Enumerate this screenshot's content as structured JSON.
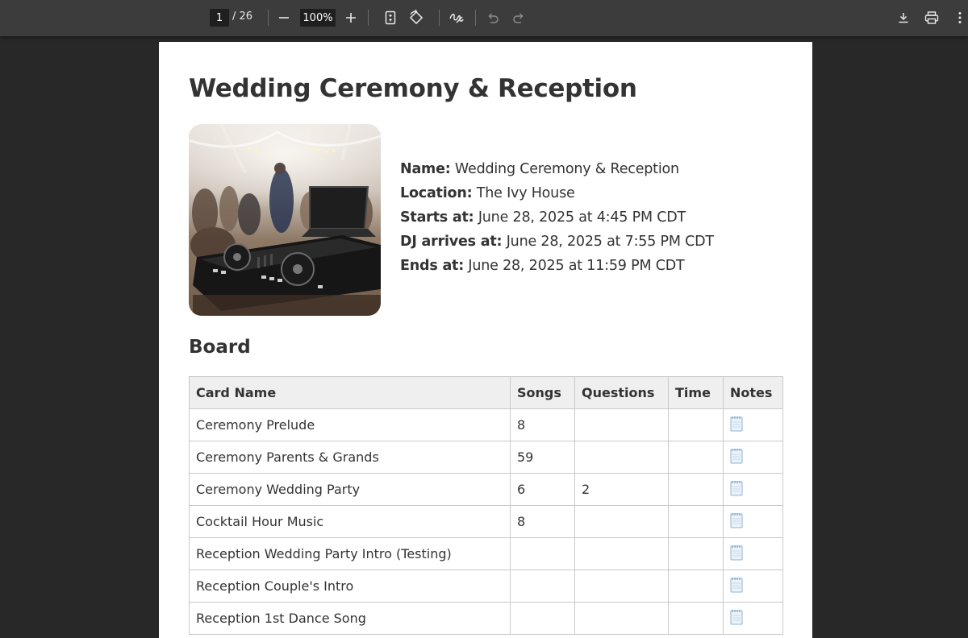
{
  "toolbar": {
    "current_page": "1",
    "total_pages": "/ 26",
    "zoom": "100%"
  },
  "document": {
    "title": "Wedding Ceremony & Reception",
    "info": [
      {
        "label": "Name:",
        "value": " Wedding Ceremony & Reception"
      },
      {
        "label": "Location:",
        "value": " The Ivy House"
      },
      {
        "label": "Starts at:",
        "value": " June 28, 2025 at 4:45 PM CDT"
      },
      {
        "label": "DJ arrives at:",
        "value": " June 28, 2025 at 7:55 PM CDT"
      },
      {
        "label": "Ends at:",
        "value": " June 28, 2025 at 11:59 PM CDT"
      }
    ],
    "board_title": "Board",
    "board": {
      "headers": [
        "Card Name",
        "Songs",
        "Questions",
        "Time",
        "Notes"
      ],
      "rows": [
        {
          "name": "Ceremony Prelude",
          "songs": "8",
          "questions": "",
          "time": ""
        },
        {
          "name": "Ceremony Parents & Grands",
          "songs": "59",
          "questions": "",
          "time": ""
        },
        {
          "name": "Ceremony Wedding Party",
          "songs": "6",
          "questions": "2",
          "time": ""
        },
        {
          "name": "Cocktail Hour Music",
          "songs": "8",
          "questions": "",
          "time": ""
        },
        {
          "name": "Reception Wedding Party Intro (Testing)",
          "songs": "",
          "questions": "",
          "time": ""
        },
        {
          "name": "Reception Couple's Intro",
          "songs": "",
          "questions": "",
          "time": ""
        },
        {
          "name": "Reception 1st Dance Song",
          "songs": "",
          "questions": "",
          "time": ""
        }
      ]
    }
  }
}
